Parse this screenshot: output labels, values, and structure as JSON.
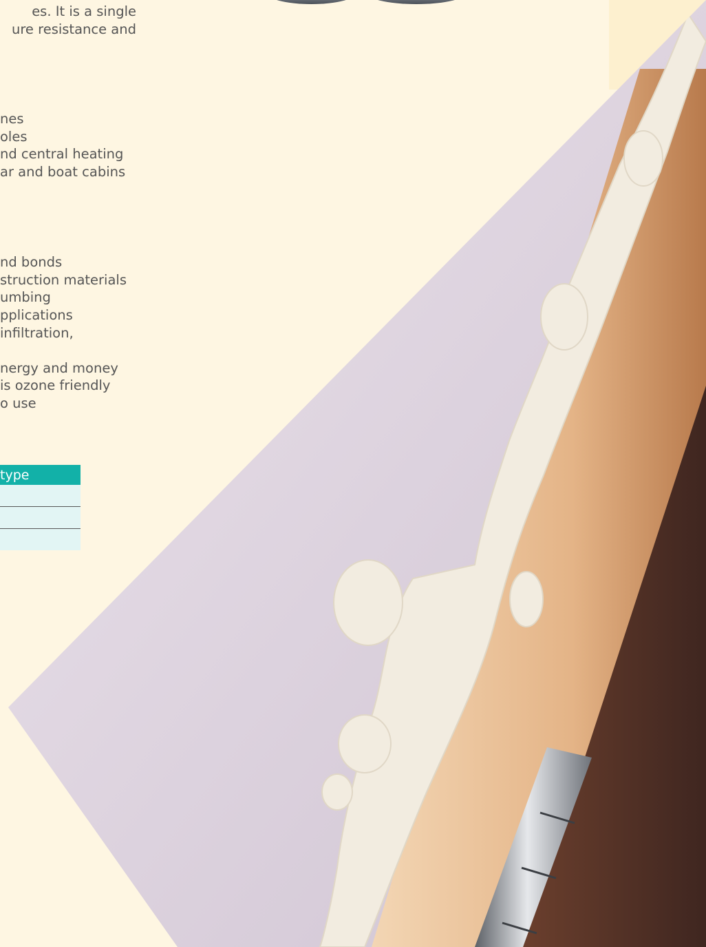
{
  "intro": {
    "lines": [
      "es.  It is a single",
      "ure resistance and"
    ]
  },
  "applications": {
    "items": [
      "nes",
      "oles",
      "nd central heating",
      "ar and boat cabins"
    ]
  },
  "features": {
    "items": [
      "nd bonds",
      "struction materials",
      "umbing",
      "pplications",
      "infiltration,",
      "",
      "nergy and money",
      "is ozone friendly",
      "o use"
    ]
  },
  "table": {
    "header": "type",
    "rows": [
      "",
      "",
      ""
    ]
  },
  "colors": {
    "background": "#fef6e2",
    "table_header": "#12b1a8",
    "table_row": "#e2f5f4",
    "wall": "#ddd5e0",
    "foam": "#f2ece0",
    "wood_frame": "#e9bf94",
    "door": "#5a352a"
  },
  "image": {
    "subject": "expanding-foam-sealant-between-wall-and-door-frame"
  }
}
